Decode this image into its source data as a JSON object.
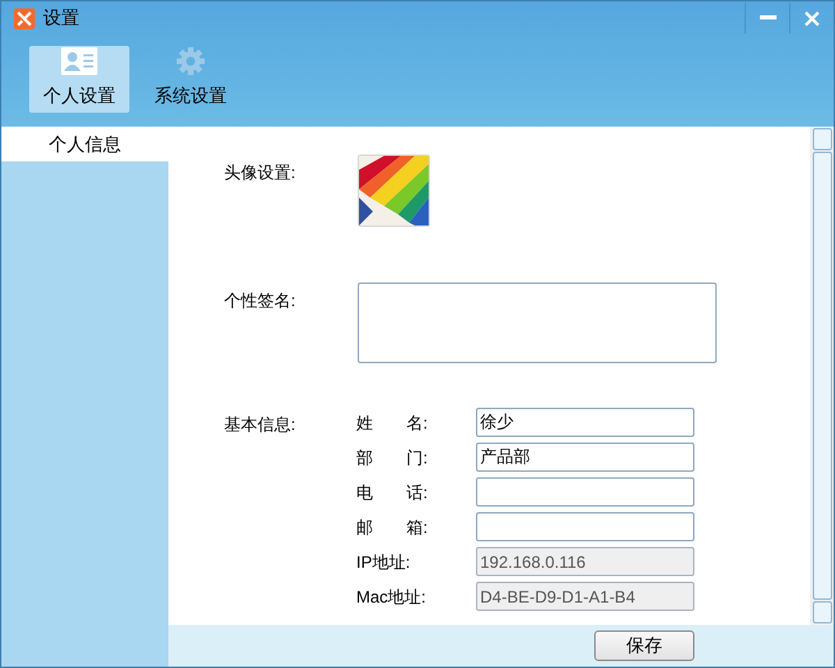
{
  "window": {
    "title": "设置"
  },
  "tabs": [
    {
      "label": "个人设置",
      "selected": true,
      "kind": "card"
    },
    {
      "label": "系统设置",
      "selected": false,
      "kind": "gear"
    }
  ],
  "sidebar": {
    "items": [
      {
        "label": "个人信息",
        "selected": true
      }
    ]
  },
  "avatar": {
    "label": "头像设置:",
    "kind": "picture"
  },
  "signature": {
    "label": "个性签名:"
  },
  "basic_info": {
    "label": "基本信息:",
    "fields": [
      {
        "label": "姓　　名:",
        "value": "徐少",
        "disabled": false
      },
      {
        "label": "部　　门:",
        "value": "产品部",
        "disabled": false
      },
      {
        "label": "电　　话:",
        "disabled": false
      },
      {
        "label": "邮　　箱:",
        "disabled": false
      },
      {
        "label": "IP地址:",
        "value": "192.168.0.116",
        "disabled": true
      },
      {
        "label": "Mac地址:",
        "value": "D4-BE-D9-D1-A1-B4",
        "disabled": true
      }
    ]
  },
  "buttons": [
    "保存"
  ]
}
